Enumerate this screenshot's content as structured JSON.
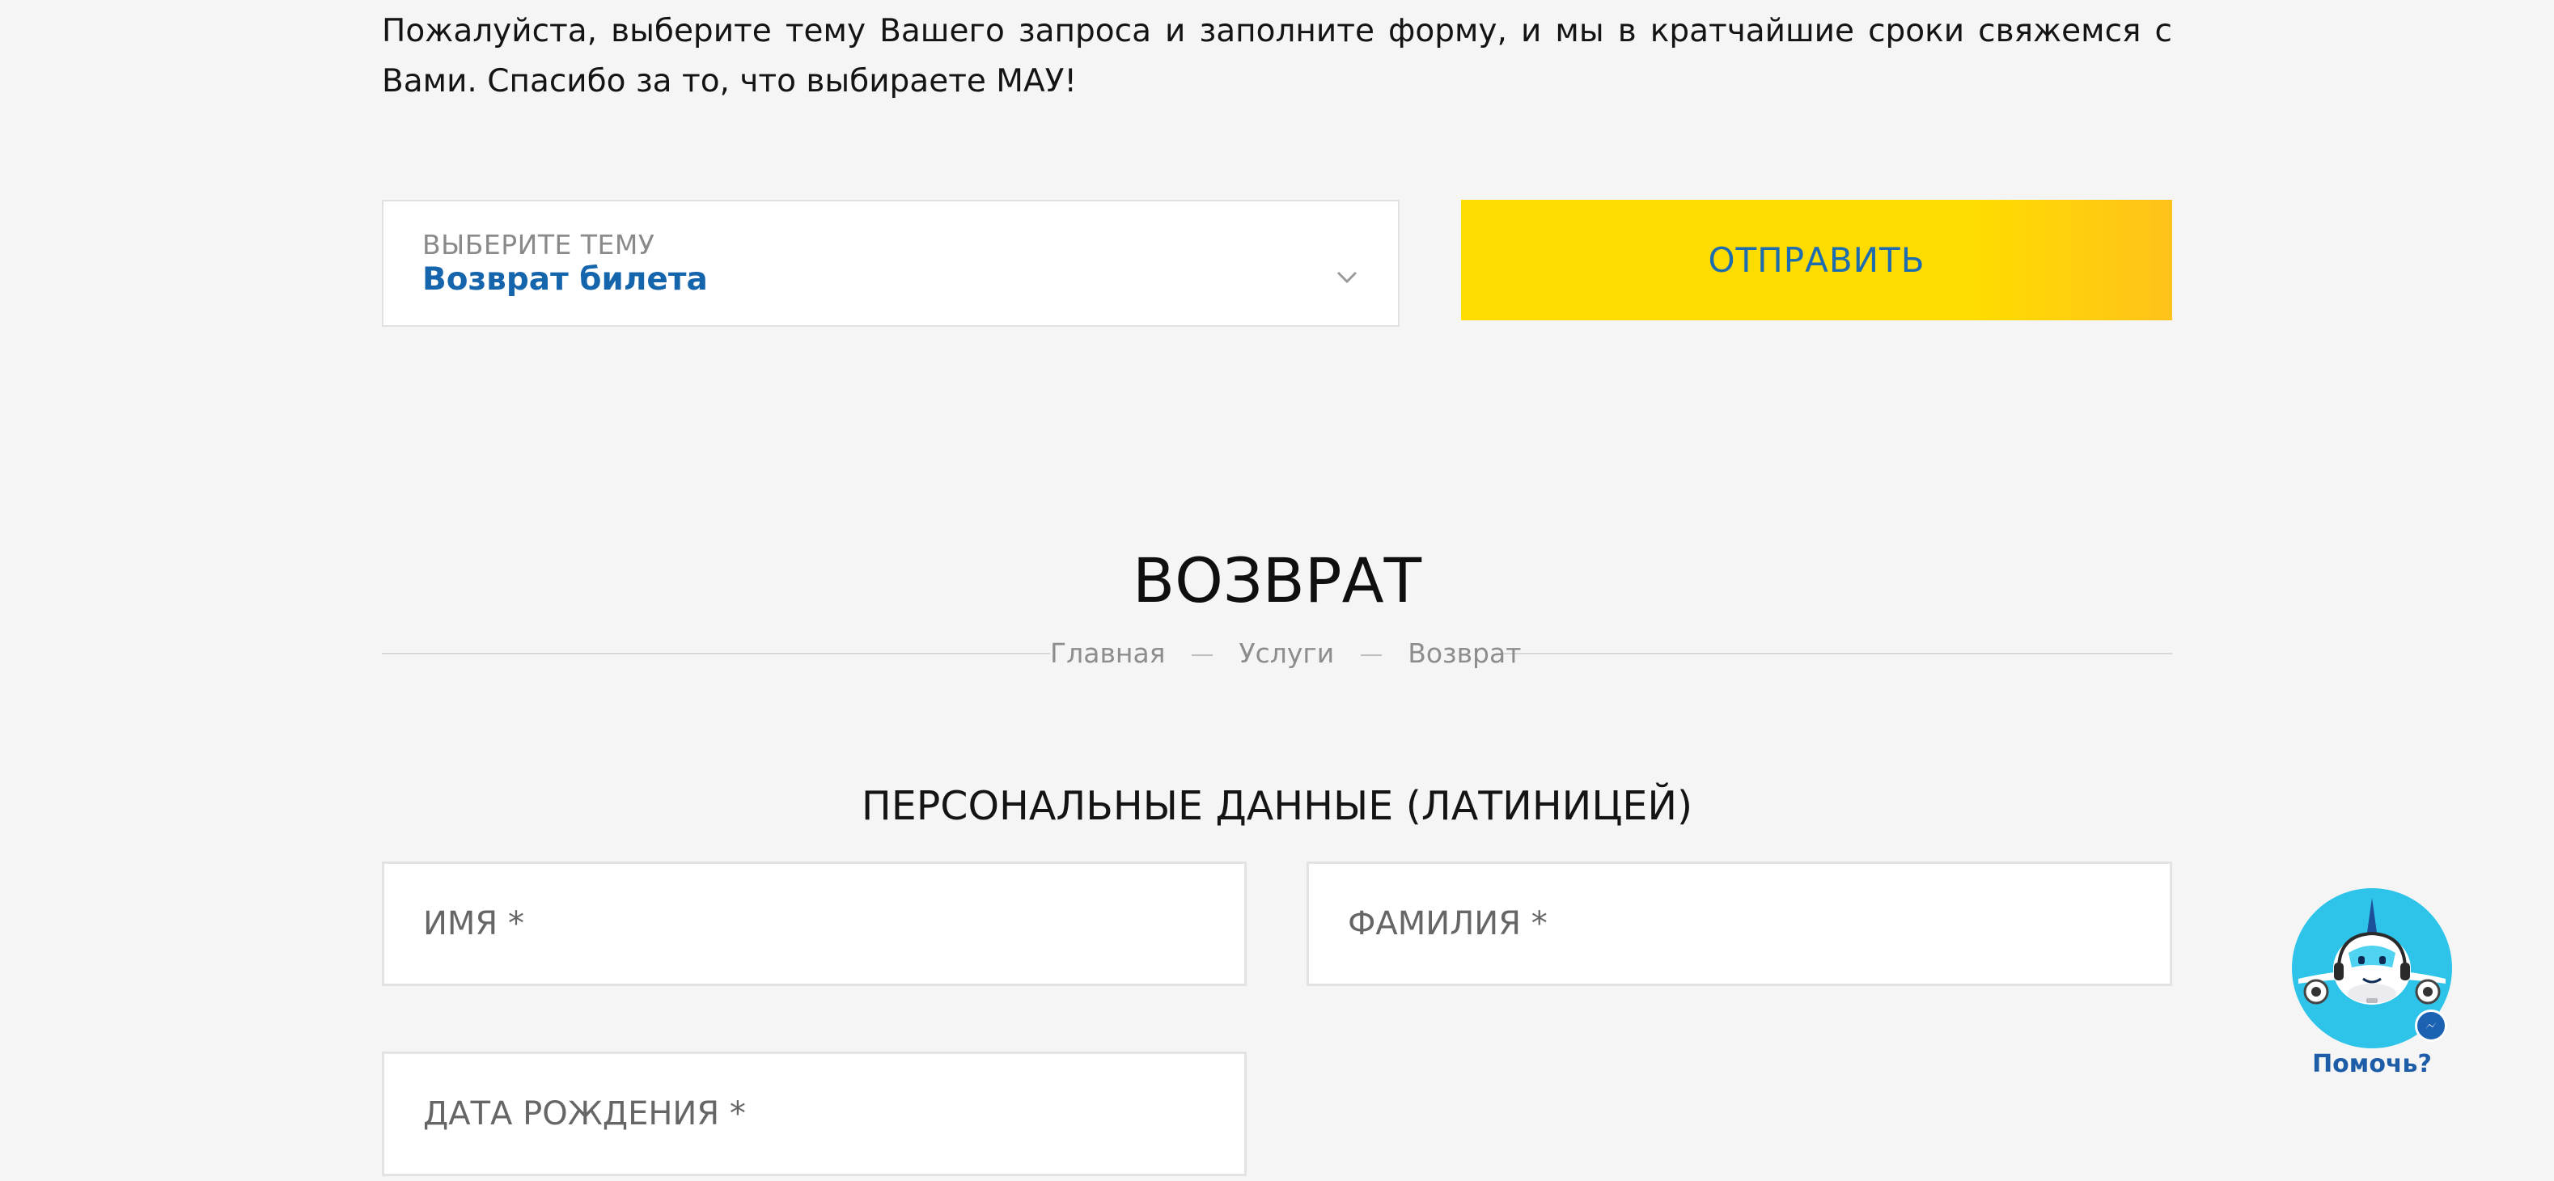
{
  "intro_text": "Пожалуйста, выберите тему Вашего запроса и заполните форму, и мы в кратчайшие сроки свяжемся с Вами. Спасибо за то, что выбираете МАУ!",
  "topic_select": {
    "caption": "ВЫБЕРИТЕ ТЕМУ",
    "value": "Возврат билета",
    "icon": "chevron-down-icon"
  },
  "submit_label": "ОТПРАВИТЬ",
  "section_title": "ВОЗВРАТ",
  "breadcrumb": [
    "Главная",
    "Услуги",
    "Возврат"
  ],
  "personal_title": "ПЕРСОНАЛЬНЫЕ ДАННЫЕ (ЛАТИНИЦЕЙ)",
  "fields": {
    "first_name_placeholder": "ИМЯ *",
    "last_name_placeholder": "ФАМИЛИЯ *",
    "dob_placeholder": "ДАТА РОЖДЕНИЯ *"
  },
  "help_widget": {
    "label": "Помочь?",
    "icon": "airplane-mascot-icon",
    "badge_icon": "messenger-icon"
  },
  "colors": {
    "background": "#f4f5f4",
    "accent_blue": "#1565ad",
    "button_yellow": "#ffdc00",
    "help_cyan": "#2ec4ea"
  }
}
